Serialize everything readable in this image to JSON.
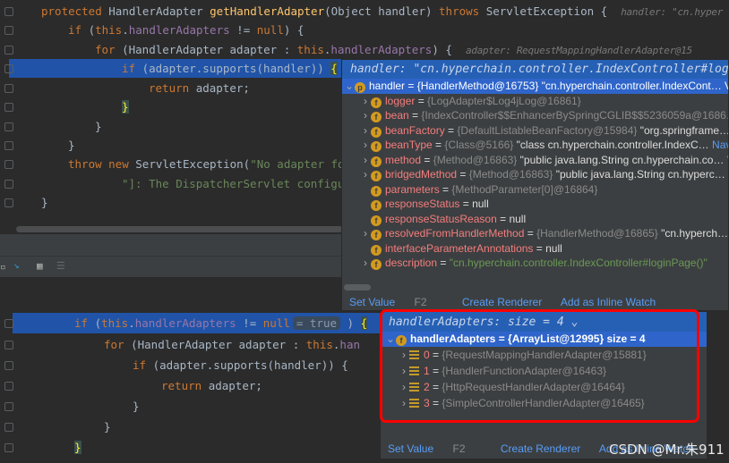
{
  "top_editor": {
    "lines": [
      [
        [
          "protected ",
          "k"
        ],
        [
          "HandlerAdapter ",
          "t"
        ],
        [
          "getHandlerAdapter",
          "f"
        ],
        [
          "(Object handler) ",
          "t"
        ],
        [
          "throws ",
          "k"
        ],
        [
          "ServletException {  ",
          "t"
        ],
        [
          "handler: \"cn.hyper",
          "hint"
        ]
      ],
      [
        [
          "if ",
          "k"
        ],
        [
          "(",
          "t"
        ],
        [
          "this",
          "k"
        ],
        [
          ".",
          "t"
        ],
        [
          "handlerAdapters",
          "p"
        ],
        [
          " != ",
          "t"
        ],
        [
          "null",
          "k"
        ],
        [
          ") {",
          "t"
        ]
      ],
      [
        [
          "for ",
          "k"
        ],
        [
          "(HandlerAdapter adapter : ",
          "t"
        ],
        [
          "this",
          "k"
        ],
        [
          ".",
          "t"
        ],
        [
          "handlerAdapters",
          "p"
        ],
        [
          ") {  ",
          "t"
        ],
        [
          "adapter: RequestMappingHandlerAdapter@15",
          "hint"
        ]
      ],
      [
        [
          "if ",
          "k"
        ],
        [
          "(adapter.supports(handler)) ",
          "t"
        ],
        [
          "{",
          "y"
        ]
      ],
      [
        [
          "return ",
          "k"
        ],
        [
          "adapter;",
          "t"
        ]
      ],
      [
        [
          "}",
          "y"
        ]
      ],
      [
        [
          "}",
          "t"
        ]
      ],
      [
        [
          "}",
          "t"
        ]
      ],
      [
        [
          "throw new ",
          "k"
        ],
        [
          "ServletException(",
          "t"
        ],
        [
          "\"No adapter fo",
          "s"
        ]
      ],
      [
        [
          "\"]: The DispatcherServlet configu",
          "s"
        ]
      ],
      [
        [
          "}",
          "t"
        ]
      ]
    ]
  },
  "bottom_editor": {
    "inline_value": "= true",
    "lines": [
      [
        [
          "if ",
          "k"
        ],
        [
          "(",
          "t"
        ],
        [
          "this",
          "k"
        ],
        [
          ".",
          "t"
        ],
        [
          "handlerAdapters",
          "p"
        ],
        [
          " != ",
          "t"
        ],
        [
          "null",
          "k"
        ]
      ],
      [
        [
          "for ",
          "k"
        ],
        [
          "(HandlerAdapter adapter : ",
          "t"
        ],
        [
          "this",
          "k"
        ],
        [
          ".",
          "t"
        ],
        [
          "han",
          "p"
        ]
      ],
      [
        [
          "if ",
          "k"
        ],
        [
          "(adapter.supports(handler)) {",
          "t"
        ]
      ],
      [
        [
          "return ",
          "k"
        ],
        [
          "adapter;",
          "t"
        ]
      ],
      [
        [
          "}",
          "t"
        ]
      ],
      [
        [
          "}",
          "t"
        ]
      ],
      [
        [
          "}",
          "y"
        ]
      ]
    ]
  },
  "popup_top": {
    "header": "handler: \"cn.hyperchain.controller.IndexController#loginPage\"",
    "root": {
      "name": "handler",
      "value": "= {HandlerMethod@16753} \"cn.hyperchain.controller.IndexCont…",
      "link": "V"
    },
    "items": [
      {
        "name": "logger",
        "ref": "{LogAdapter$Log4jLog@16861}",
        "val": "",
        "link": "",
        "expand": true
      },
      {
        "name": "bean",
        "ref": "{IndexController$$EnhancerBySpringCGLIB$$5236059a@1686…",
        "val": "",
        "link": "V",
        "expand": true
      },
      {
        "name": "beanFactory",
        "ref": "{DefaultListableBeanFactory@15984}",
        "val": "\"org.springframe…",
        "link": "V",
        "expand": true
      },
      {
        "name": "beanType",
        "ref": "{Class@5166}",
        "val": "\"class cn.hyperchain.controller.IndexC…",
        "link": "Navig",
        "expand": true
      },
      {
        "name": "method",
        "ref": "{Method@16863}",
        "val": "\"public java.lang.String cn.hyperchain.co…",
        "link": "V",
        "expand": true
      },
      {
        "name": "bridgedMethod",
        "ref": "{Method@16863}",
        "val": "\"public java.lang.String cn.hyperc…",
        "link": "V",
        "expand": true
      },
      {
        "name": "parameters",
        "ref": "{MethodParameter[0]@16864}",
        "val": "",
        "link": "",
        "expand": false
      },
      {
        "name": "responseStatus",
        "ref": "",
        "val": "null",
        "link": "",
        "expand": false
      },
      {
        "name": "responseStatusReason",
        "ref": "",
        "val": "null",
        "link": "",
        "expand": false
      },
      {
        "name": "resolvedFromHandlerMethod",
        "ref": "{HandlerMethod@16865}",
        "val": "\"cn.hyperch…",
        "link": "V",
        "expand": true
      },
      {
        "name": "interfaceParameterAnnotations",
        "ref": "",
        "val": "null",
        "link": "",
        "expand": false
      },
      {
        "name": "description",
        "ref": "",
        "val": "",
        "str": "\"cn.hyperchain.controller.IndexController#loginPage()\"",
        "link": "",
        "expand": true
      }
    ],
    "footer": {
      "set_value": "Set Value",
      "key": "F2",
      "create_renderer": "Create Renderer",
      "inline_watch": "Add as Inline Watch"
    }
  },
  "popup_bottom": {
    "header": "handlerAdapters:  size = 4",
    "root": {
      "name": "handlerAdapters",
      "value": "= {ArrayList@12995}  size = 4"
    },
    "items": [
      {
        "index": "0",
        "ref": "{RequestMappingHandlerAdapter@15881}"
      },
      {
        "index": "1",
        "ref": "{HandlerFunctionAdapter@16463}"
      },
      {
        "index": "2",
        "ref": "{HttpRequestHandlerAdapter@16464}"
      },
      {
        "index": "3",
        "ref": "{SimpleControllerHandlerAdapter@16465}"
      }
    ],
    "footer": {
      "set_value": "Set Value",
      "key": "F2",
      "create_renderer": "Create Renderer",
      "inline_watch": "Add as Inline Watch"
    },
    "highlight_color": "#ff0000"
  },
  "watermark": "CSDN @Mr.朱911"
}
